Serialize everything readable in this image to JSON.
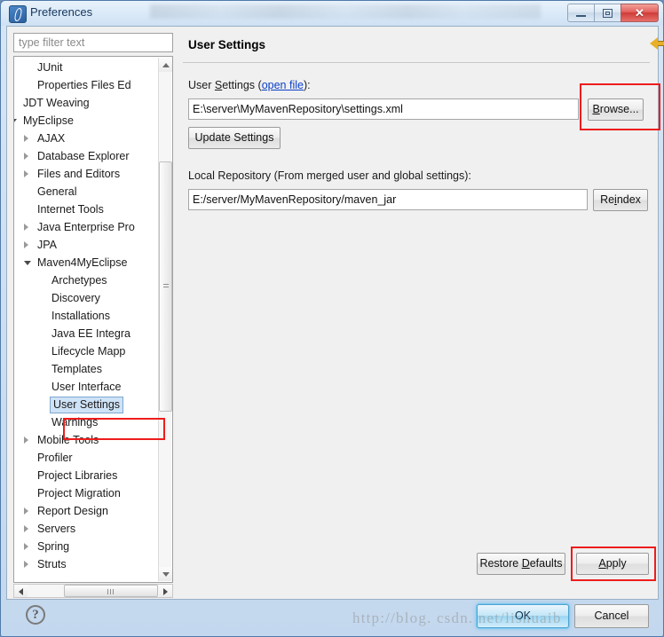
{
  "window": {
    "title": "Preferences",
    "icon": "myeclipse-icon",
    "controls": {
      "minimize": "minimize-button",
      "maximize": "maximize-button",
      "close": "close-button",
      "close_glyph": "✕"
    }
  },
  "filter": {
    "placeholder": "type filter text",
    "value": ""
  },
  "tree": {
    "items": [
      {
        "label": "JUnit",
        "indent": 2,
        "arrow": "none",
        "selected": false
      },
      {
        "label": "Properties Files Ed",
        "indent": 2,
        "arrow": "none",
        "selected": false
      },
      {
        "label": "JDT Weaving",
        "indent": 1,
        "arrow": "none",
        "selected": false
      },
      {
        "label": "MyEclipse",
        "indent": 1,
        "arrow": "expanded",
        "selected": false
      },
      {
        "label": "AJAX",
        "indent": 2,
        "arrow": "collapsed",
        "selected": false
      },
      {
        "label": "Database Explorer",
        "indent": 2,
        "arrow": "collapsed",
        "selected": false
      },
      {
        "label": "Files and Editors",
        "indent": 2,
        "arrow": "collapsed",
        "selected": false
      },
      {
        "label": "General",
        "indent": 2,
        "arrow": "none",
        "selected": false
      },
      {
        "label": "Internet Tools",
        "indent": 2,
        "arrow": "none",
        "selected": false
      },
      {
        "label": "Java Enterprise Pro",
        "indent": 2,
        "arrow": "collapsed",
        "selected": false
      },
      {
        "label": "JPA",
        "indent": 2,
        "arrow": "collapsed",
        "selected": false
      },
      {
        "label": "Maven4MyEclipse",
        "indent": 2,
        "arrow": "expanded",
        "selected": false
      },
      {
        "label": "Archetypes",
        "indent": 3,
        "arrow": "none",
        "selected": false
      },
      {
        "label": "Discovery",
        "indent": 3,
        "arrow": "none",
        "selected": false
      },
      {
        "label": "Installations",
        "indent": 3,
        "arrow": "none",
        "selected": false
      },
      {
        "label": "Java EE Integra",
        "indent": 3,
        "arrow": "none",
        "selected": false
      },
      {
        "label": "Lifecycle Mapp",
        "indent": 3,
        "arrow": "none",
        "selected": false
      },
      {
        "label": "Templates",
        "indent": 3,
        "arrow": "none",
        "selected": false
      },
      {
        "label": "User Interface",
        "indent": 3,
        "arrow": "none",
        "selected": false
      },
      {
        "label": "User Settings",
        "indent": 3,
        "arrow": "none",
        "selected": true
      },
      {
        "label": "Warnings",
        "indent": 3,
        "arrow": "none",
        "selected": false
      },
      {
        "label": "Mobile Tools",
        "indent": 2,
        "arrow": "collapsed",
        "selected": false
      },
      {
        "label": "Profiler",
        "indent": 2,
        "arrow": "none",
        "selected": false
      },
      {
        "label": "Project Libraries",
        "indent": 2,
        "arrow": "none",
        "selected": false
      },
      {
        "label": "Project Migration",
        "indent": 2,
        "arrow": "none",
        "selected": false
      },
      {
        "label": "Report Design",
        "indent": 2,
        "arrow": "collapsed",
        "selected": false
      },
      {
        "label": "Servers",
        "indent": 2,
        "arrow": "collapsed",
        "selected": false
      },
      {
        "label": "Spring",
        "indent": 2,
        "arrow": "collapsed",
        "selected": false
      },
      {
        "label": "Struts",
        "indent": 2,
        "arrow": "collapsed",
        "selected": false
      }
    ]
  },
  "page": {
    "title": "User Settings",
    "nav": {
      "back": "back-arrow-icon",
      "forward": "forward-arrow-icon"
    },
    "user_settings": {
      "label_prefix": "User ",
      "label_mnemonic": "S",
      "label_rest": "ettings (",
      "link": "open file",
      "label_suffix": "):",
      "value": "E:\\server\\MyMavenRepository\\settings.xml",
      "browse_mnemonic": "B",
      "browse_rest": "rowse...",
      "update_label": "Update Settings"
    },
    "local_repository": {
      "label": "Local Repository (From merged user and global settings):",
      "value": "E:/server/MyMavenRepository/maven_jar",
      "reindex_prefix": "Re",
      "reindex_mnemonic": "i",
      "reindex_rest": "ndex"
    },
    "restore_defaults": {
      "prefix": "Restore ",
      "mnemonic": "D",
      "rest": "efaults"
    },
    "apply": {
      "prefix": "",
      "mnemonic": "A",
      "rest": "pply"
    }
  },
  "footer": {
    "help": "?",
    "ok": "OK",
    "cancel": "Cancel"
  },
  "watermark": "http://blog. csdn. net/lishuaib",
  "colors": {
    "highlight_red": "#ee1c1c",
    "selection_blue": "#cfe3f7",
    "link_blue": "#0b3fc8",
    "back_arrow_gold": "#e8b028"
  }
}
